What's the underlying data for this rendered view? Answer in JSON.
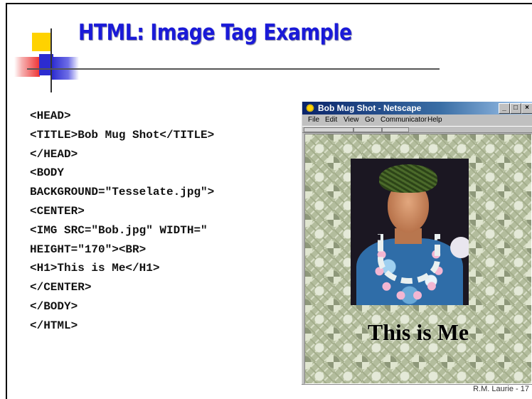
{
  "slide": {
    "title": "HTML: Image Tag Example",
    "footer": "R.M. Laurie - 17"
  },
  "code_lines": [
    "<HEAD>",
    "<TITLE>Bob Mug Shot</TITLE>",
    "</HEAD>",
    "<BODY",
    "BACKGROUND=\"Tesselate.jpg\">",
    "<CENTER>",
    "<IMG SRC=\"Bob.jpg\" WIDTH=\"",
    "HEIGHT=\"170\"><BR>",
    "<H1>This is Me</H1>",
    "</CENTER>",
    "</BODY>",
    "</HTML>"
  ],
  "browser": {
    "window_title": "Bob Mug Shot - Netscape",
    "app_icon": "netscape-icon",
    "menu": [
      "File",
      "Edit",
      "View",
      "Go",
      "Communicator",
      "Help"
    ],
    "page_heading": "This is Me",
    "colors": {
      "titlebar_start": "#0a246a",
      "titlebar_end": "#a6caf0",
      "tile_background": "#b3bd9d"
    }
  },
  "colors": {
    "title": "#1a1ad8",
    "logo_yellow": "#ffd200",
    "logo_red": "#ee3333",
    "logo_blue": "#2c2cd0"
  }
}
